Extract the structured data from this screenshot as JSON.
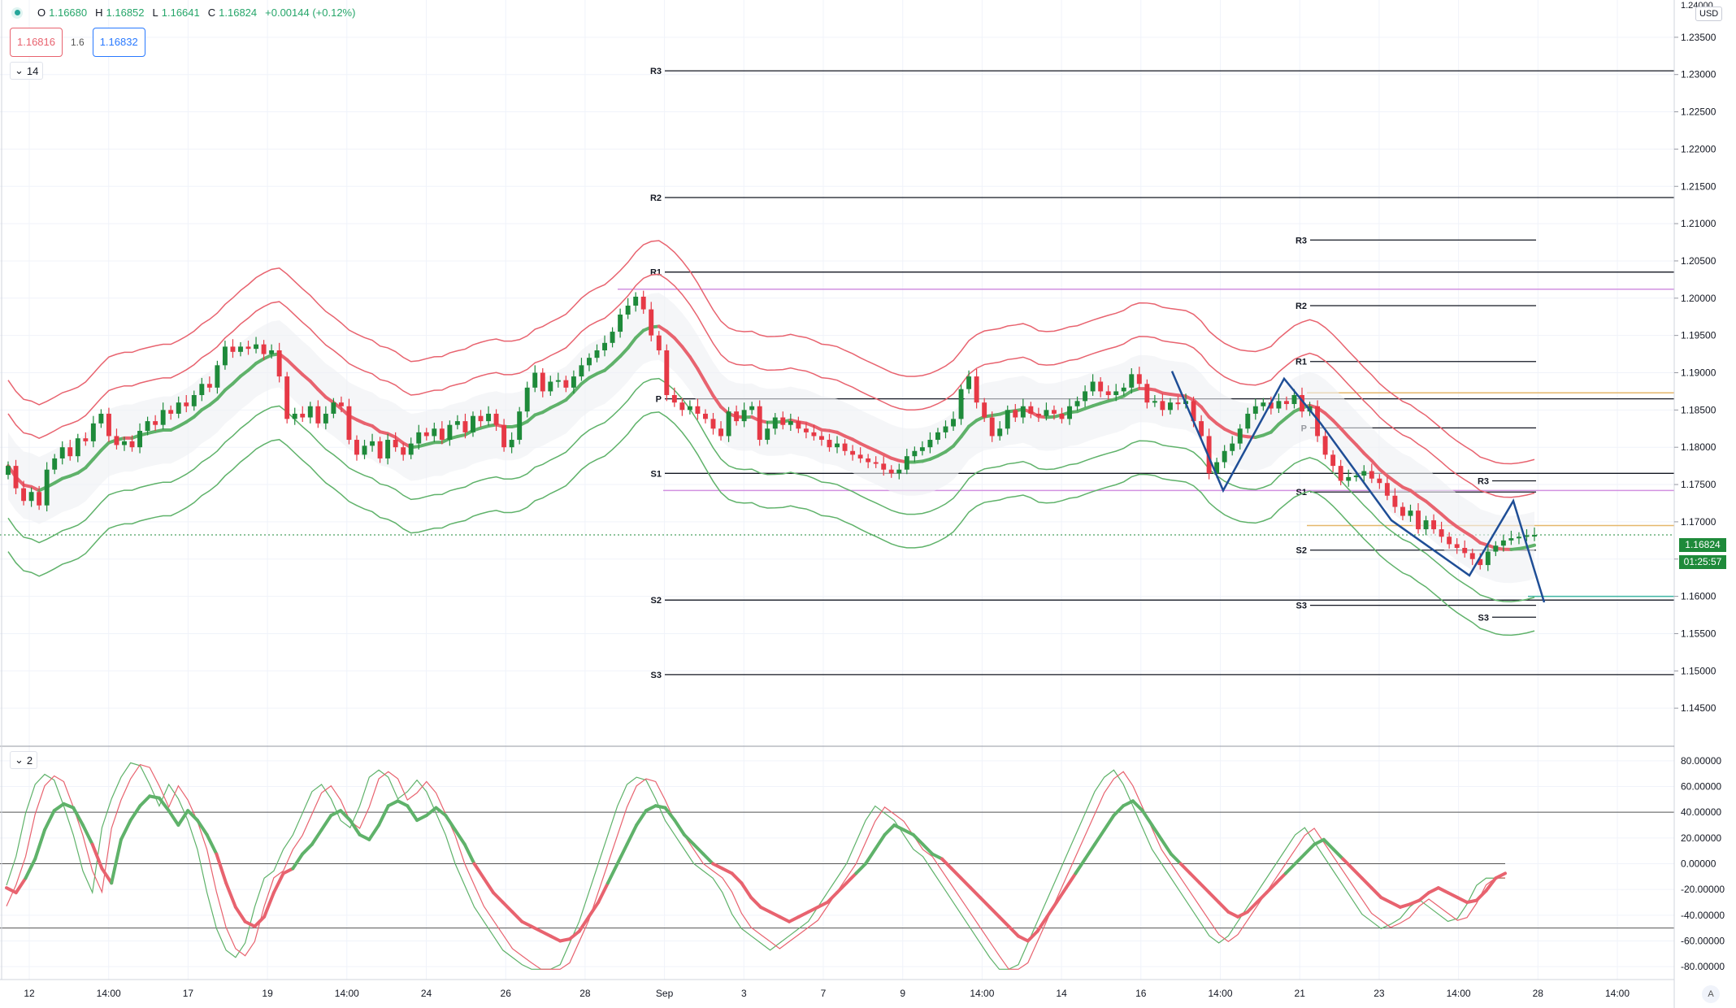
{
  "legend": {
    "open_label": "O",
    "open": "1.16680",
    "high_label": "H",
    "high": "1.16852",
    "low_label": "L",
    "low": "1.16641",
    "close_label": "C",
    "close": "1.16824",
    "change": "+0.00144 (+0.12%)"
  },
  "trade": {
    "sell_price": "1.16816",
    "spread": "1.6",
    "buy_price": "1.16832"
  },
  "main_pane": {
    "collapse_label": "14"
  },
  "oscillator_pane": {
    "collapse_label": "2"
  },
  "currency": "USD",
  "current_price_tag": "1.16824",
  "countdown_tag": "01:25:57",
  "corner_button": "A",
  "colors": {
    "bull": "#1e8a3a",
    "bear": "#e63946",
    "band_red": "#e8636f",
    "band_green": "#5fb26a",
    "zigzag": "#1f4e96",
    "pivot": "#131722",
    "magenta": "#d291e0",
    "orange": "#e5b76b"
  },
  "chart_data": [
    {
      "type": "candlestick",
      "title": "",
      "x_ticks": [
        "12",
        "14:00",
        "17",
        "19",
        "14:00",
        "24",
        "26",
        "28",
        "Sep",
        "3",
        "7",
        "9",
        "14:00",
        "14",
        "16",
        "14:00",
        "21",
        "23",
        "14:00",
        "28",
        "14:00"
      ],
      "y_ticks": [
        "1.23500",
        "1.23000",
        "1.22500",
        "1.22000",
        "1.21500",
        "1.21000",
        "1.20500",
        "1.20000",
        "1.19500",
        "1.19000",
        "1.18500",
        "1.18000",
        "1.17500",
        "1.17000",
        "1.16500",
        "1.16000",
        "1.15500",
        "1.15000",
        "1.14500"
      ],
      "y_top_label": "1.24000",
      "ylim": [
        1.14,
        1.24
      ],
      "last_price": 1.16824,
      "close_series": [
        1.1775,
        1.1745,
        1.1728,
        1.174,
        1.1722,
        1.177,
        1.1785,
        1.18,
        1.1788,
        1.1812,
        1.1808,
        1.1832,
        1.1845,
        1.1815,
        1.1803,
        1.1808,
        1.18,
        1.1822,
        1.1835,
        1.183,
        1.185,
        1.1845,
        1.186,
        1.1855,
        1.187,
        1.1885,
        1.188,
        1.191,
        1.1935,
        1.1928,
        1.1935,
        1.1932,
        1.1938,
        1.1925,
        1.193,
        1.1895,
        1.1838,
        1.1845,
        1.184,
        1.1855,
        1.1832,
        1.1845,
        1.186,
        1.1855,
        1.181,
        1.179,
        1.1802,
        1.1808,
        1.1785,
        1.181,
        1.18,
        1.179,
        1.1805,
        1.182,
        1.1815,
        1.1825,
        1.181,
        1.183,
        1.1835,
        1.182,
        1.1842,
        1.1835,
        1.1845,
        1.183,
        1.18,
        1.181,
        1.1848,
        1.188,
        1.19,
        1.1875,
        1.1888,
        1.189,
        1.188,
        1.1895,
        1.191,
        1.192,
        1.193,
        1.194,
        1.1955,
        1.1978,
        1.199,
        1.2002,
        1.1985,
        1.195,
        1.193,
        1.187,
        1.186,
        1.185,
        1.1855,
        1.1845,
        1.1838,
        1.1825,
        1.1815,
        1.1848,
        1.1835,
        1.185,
        1.1855,
        1.181,
        1.1825,
        1.184,
        1.183,
        1.1835,
        1.1825,
        1.182,
        1.1815,
        1.181,
        1.18,
        1.1805,
        1.1795,
        1.179,
        1.1785,
        1.178,
        1.1778,
        1.177,
        1.1765,
        1.177,
        1.1788,
        1.1795,
        1.18,
        1.181,
        1.182,
        1.1828,
        1.1838,
        1.1878,
        1.1895,
        1.186,
        1.184,
        1.1815,
        1.1825,
        1.185,
        1.184,
        1.1855,
        1.1845,
        1.1842,
        1.185,
        1.1845,
        1.1838,
        1.1855,
        1.1862,
        1.1875,
        1.1888,
        1.1875,
        1.187,
        1.1875,
        1.188,
        1.1898,
        1.1885,
        1.186,
        1.1862,
        1.185,
        1.186,
        1.1858,
        1.1862,
        1.1835,
        1.1815,
        1.1765,
        1.178,
        1.1795,
        1.1805,
        1.1825,
        1.1845,
        1.1855,
        1.186,
        1.1852,
        1.1862,
        1.1858,
        1.187,
        1.1848,
        1.1855,
        1.1815,
        1.179,
        1.1775,
        1.1755,
        1.176,
        1.1762,
        1.1768,
        1.1758,
        1.1752,
        1.1735,
        1.172,
        1.1708,
        1.1715,
        1.169,
        1.1702,
        1.169,
        1.168,
        1.167,
        1.1665,
        1.1658,
        1.165,
        1.1642,
        1.166,
        1.1668,
        1.1675,
        1.1678,
        1.168,
        1.1682,
        1.16824
      ],
      "pivots_wide": {
        "R3": 1.2305,
        "R2": 1.2135,
        "R1": 1.2035,
        "P": 1.1865,
        "S1": 1.1765,
        "S2": 1.1595,
        "S3": 1.1495
      },
      "pivots_narrow": {
        "R3": 1.2078,
        "R2": 1.199,
        "R1": 1.1915,
        "P": 1.1826,
        "S1": 1.174,
        "S2": 1.1662,
        "S3": 1.1588
      },
      "pivots_narrow2": {
        "R3": 1.1755,
        "S3": 1.1572
      },
      "horizontal_levels": {
        "magenta_upper": 1.2012,
        "magenta_lower": 1.1742,
        "orange_upper": 1.1873,
        "orange_lower": 1.1695,
        "teal": 1.16
      },
      "zigzag": [
        [
          1442,
          1.1902
        ],
        [
          1505,
          1.1742
        ],
        [
          1580,
          1.1892
        ],
        [
          1625,
          1.1832
        ],
        [
          1712,
          1.1702
        ],
        [
          1808,
          1.1628
        ],
        [
          1862,
          1.1728
        ],
        [
          1900,
          1.1592
        ]
      ],
      "pivot_labels": {
        "wide": [
          "R3",
          "R2",
          "R1",
          "P",
          "S1",
          "S2",
          "S3"
        ],
        "narrow": [
          "R3",
          "R2",
          "R1",
          "P",
          "S1",
          "S2",
          "S3"
        ],
        "narrow2": [
          "R3",
          "S3"
        ]
      }
    },
    {
      "type": "line",
      "title": "",
      "y_ticks": [
        "80.00000",
        "60.00000",
        "40.00000",
        "20.00000",
        "0.00000",
        "-20.00000",
        "-40.00000",
        "-60.00000",
        "-80.00000"
      ],
      "ylim": [
        -90,
        90
      ],
      "levels": [
        40,
        0,
        -50
      ],
      "series": [
        {
          "values": [
            -25,
            -30,
            -15,
            5,
            35,
            55,
            62,
            58,
            40,
            20,
            -5,
            -20,
            25,
            45,
            60,
            70,
            68,
            55,
            40,
            55,
            45,
            30,
            10,
            -20,
            -45,
            -60,
            -65,
            -55,
            -30,
            -10,
            -5,
            10,
            20,
            35,
            50,
            55,
            45,
            30,
            25,
            40,
            60,
            65,
            60,
            45,
            50,
            58,
            50,
            35,
            20,
            0,
            -15,
            -30,
            -40,
            -50,
            -60,
            -65,
            -70,
            -75,
            -80,
            -78,
            -70,
            -55,
            -40,
            -20,
            0,
            20,
            40,
            55,
            60,
            58,
            45,
            30,
            20,
            10,
            0,
            -5,
            -10,
            -20,
            -35,
            -45,
            -50,
            -55,
            -60,
            -55,
            -50,
            -45,
            -40,
            -30,
            -20,
            -10,
            0,
            15,
            30,
            40,
            35,
            30,
            20,
            10,
            5,
            -5,
            -15,
            -25,
            -35,
            -45,
            -55,
            -65,
            -75,
            -80,
            -70,
            -55,
            -40,
            -25,
            -10,
            5,
            20,
            35,
            50,
            60,
            65,
            55,
            40,
            25,
            10,
            0,
            -10,
            -20,
            -30,
            -40,
            -50,
            -55,
            -50,
            -40,
            -30,
            -20,
            -10,
            0,
            10,
            20,
            25,
            15,
            5,
            -5,
            -15,
            -25,
            -35,
            -40,
            -45,
            -42,
            -38,
            -30,
            -25,
            -30,
            -35,
            -40,
            -38,
            -28,
            -15,
            -10
          ]
        }
      ]
    }
  ]
}
